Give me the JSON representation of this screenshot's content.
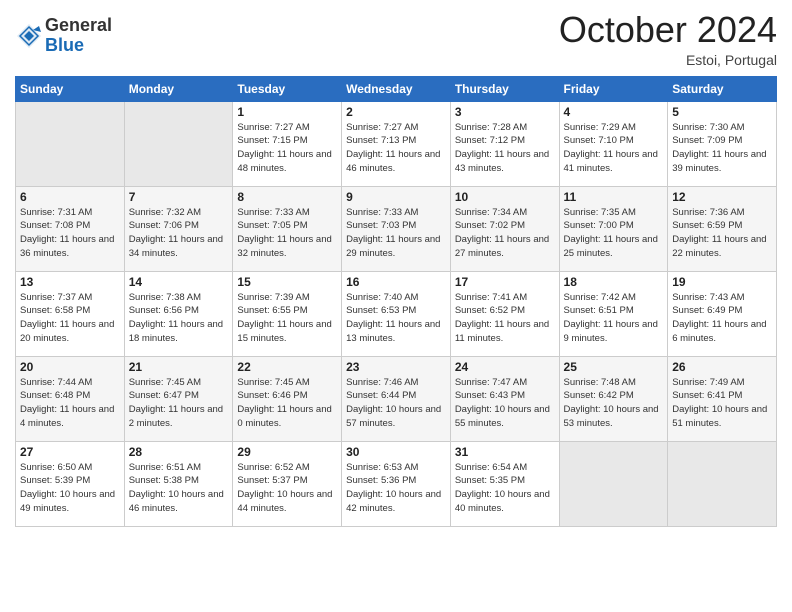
{
  "logo": {
    "general": "General",
    "blue": "Blue"
  },
  "header": {
    "month": "October 2024",
    "location": "Estoi, Portugal"
  },
  "days_of_week": [
    "Sunday",
    "Monday",
    "Tuesday",
    "Wednesday",
    "Thursday",
    "Friday",
    "Saturday"
  ],
  "weeks": [
    [
      {
        "day": "",
        "info": ""
      },
      {
        "day": "",
        "info": ""
      },
      {
        "day": "1",
        "info": "Sunrise: 7:27 AM\nSunset: 7:15 PM\nDaylight: 11 hours\nand 48 minutes."
      },
      {
        "day": "2",
        "info": "Sunrise: 7:27 AM\nSunset: 7:13 PM\nDaylight: 11 hours\nand 46 minutes."
      },
      {
        "day": "3",
        "info": "Sunrise: 7:28 AM\nSunset: 7:12 PM\nDaylight: 11 hours\nand 43 minutes."
      },
      {
        "day": "4",
        "info": "Sunrise: 7:29 AM\nSunset: 7:10 PM\nDaylight: 11 hours\nand 41 minutes."
      },
      {
        "day": "5",
        "info": "Sunrise: 7:30 AM\nSunset: 7:09 PM\nDaylight: 11 hours\nand 39 minutes."
      }
    ],
    [
      {
        "day": "6",
        "info": "Sunrise: 7:31 AM\nSunset: 7:08 PM\nDaylight: 11 hours\nand 36 minutes."
      },
      {
        "day": "7",
        "info": "Sunrise: 7:32 AM\nSunset: 7:06 PM\nDaylight: 11 hours\nand 34 minutes."
      },
      {
        "day": "8",
        "info": "Sunrise: 7:33 AM\nSunset: 7:05 PM\nDaylight: 11 hours\nand 32 minutes."
      },
      {
        "day": "9",
        "info": "Sunrise: 7:33 AM\nSunset: 7:03 PM\nDaylight: 11 hours\nand 29 minutes."
      },
      {
        "day": "10",
        "info": "Sunrise: 7:34 AM\nSunset: 7:02 PM\nDaylight: 11 hours\nand 27 minutes."
      },
      {
        "day": "11",
        "info": "Sunrise: 7:35 AM\nSunset: 7:00 PM\nDaylight: 11 hours\nand 25 minutes."
      },
      {
        "day": "12",
        "info": "Sunrise: 7:36 AM\nSunset: 6:59 PM\nDaylight: 11 hours\nand 22 minutes."
      }
    ],
    [
      {
        "day": "13",
        "info": "Sunrise: 7:37 AM\nSunset: 6:58 PM\nDaylight: 11 hours\nand 20 minutes."
      },
      {
        "day": "14",
        "info": "Sunrise: 7:38 AM\nSunset: 6:56 PM\nDaylight: 11 hours\nand 18 minutes."
      },
      {
        "day": "15",
        "info": "Sunrise: 7:39 AM\nSunset: 6:55 PM\nDaylight: 11 hours\nand 15 minutes."
      },
      {
        "day": "16",
        "info": "Sunrise: 7:40 AM\nSunset: 6:53 PM\nDaylight: 11 hours\nand 13 minutes."
      },
      {
        "day": "17",
        "info": "Sunrise: 7:41 AM\nSunset: 6:52 PM\nDaylight: 11 hours\nand 11 minutes."
      },
      {
        "day": "18",
        "info": "Sunrise: 7:42 AM\nSunset: 6:51 PM\nDaylight: 11 hours\nand 9 minutes."
      },
      {
        "day": "19",
        "info": "Sunrise: 7:43 AM\nSunset: 6:49 PM\nDaylight: 11 hours\nand 6 minutes."
      }
    ],
    [
      {
        "day": "20",
        "info": "Sunrise: 7:44 AM\nSunset: 6:48 PM\nDaylight: 11 hours\nand 4 minutes."
      },
      {
        "day": "21",
        "info": "Sunrise: 7:45 AM\nSunset: 6:47 PM\nDaylight: 11 hours\nand 2 minutes."
      },
      {
        "day": "22",
        "info": "Sunrise: 7:45 AM\nSunset: 6:46 PM\nDaylight: 11 hours\nand 0 minutes."
      },
      {
        "day": "23",
        "info": "Sunrise: 7:46 AM\nSunset: 6:44 PM\nDaylight: 10 hours\nand 57 minutes."
      },
      {
        "day": "24",
        "info": "Sunrise: 7:47 AM\nSunset: 6:43 PM\nDaylight: 10 hours\nand 55 minutes."
      },
      {
        "day": "25",
        "info": "Sunrise: 7:48 AM\nSunset: 6:42 PM\nDaylight: 10 hours\nand 53 minutes."
      },
      {
        "day": "26",
        "info": "Sunrise: 7:49 AM\nSunset: 6:41 PM\nDaylight: 10 hours\nand 51 minutes."
      }
    ],
    [
      {
        "day": "27",
        "info": "Sunrise: 6:50 AM\nSunset: 5:39 PM\nDaylight: 10 hours\nand 49 minutes."
      },
      {
        "day": "28",
        "info": "Sunrise: 6:51 AM\nSunset: 5:38 PM\nDaylight: 10 hours\nand 46 minutes."
      },
      {
        "day": "29",
        "info": "Sunrise: 6:52 AM\nSunset: 5:37 PM\nDaylight: 10 hours\nand 44 minutes."
      },
      {
        "day": "30",
        "info": "Sunrise: 6:53 AM\nSunset: 5:36 PM\nDaylight: 10 hours\nand 42 minutes."
      },
      {
        "day": "31",
        "info": "Sunrise: 6:54 AM\nSunset: 5:35 PM\nDaylight: 10 hours\nand 40 minutes."
      },
      {
        "day": "",
        "info": ""
      },
      {
        "day": "",
        "info": ""
      }
    ]
  ]
}
